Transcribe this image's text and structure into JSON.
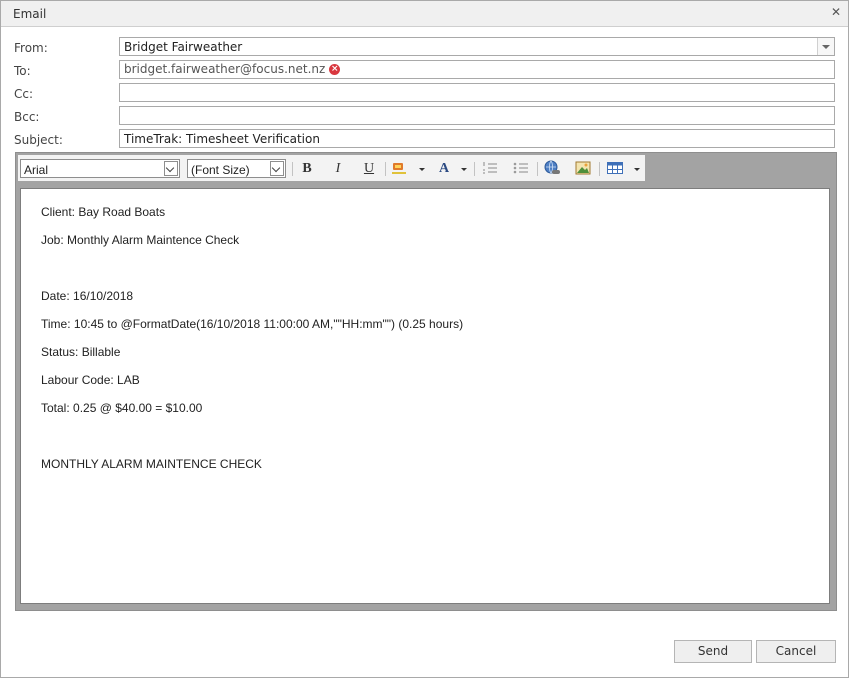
{
  "dialog": {
    "title": "Email",
    "close_icon": "close-icon"
  },
  "form": {
    "from_label": "From:",
    "from_value": "Bridget Fairweather",
    "to_label": "To:",
    "to_recipients": [
      "bridget.fairweather@focus.net.nz"
    ],
    "cc_label": "Cc:",
    "cc_value": "",
    "bcc_label": "Bcc:",
    "bcc_value": "",
    "subject_label": "Subject:",
    "subject_value": "TimeTrak: Timesheet Verification"
  },
  "toolbar": {
    "font_family": "Arial",
    "font_size": "(Font Size)",
    "bold": "B",
    "italic": "I",
    "underline": "U",
    "font_color": "A"
  },
  "body": {
    "lines": [
      "Client: Bay Road Boats",
      "Job: Monthly Alarm Maintence Check",
      "",
      "Date: 16/10/2018",
      "Time: 10:45 to @FormatDate(16/10/2018 11:00:00 AM,\"\"HH:mm\"\") (0.25 hours)",
      "Status: Billable",
      "Labour Code: LAB",
      "Total: 0.25 @ $40.00 = $10.00",
      "",
      "MONTHLY ALARM MAINTENCE CHECK"
    ]
  },
  "actions": {
    "send_label": "Send",
    "cancel_label": "Cancel"
  }
}
